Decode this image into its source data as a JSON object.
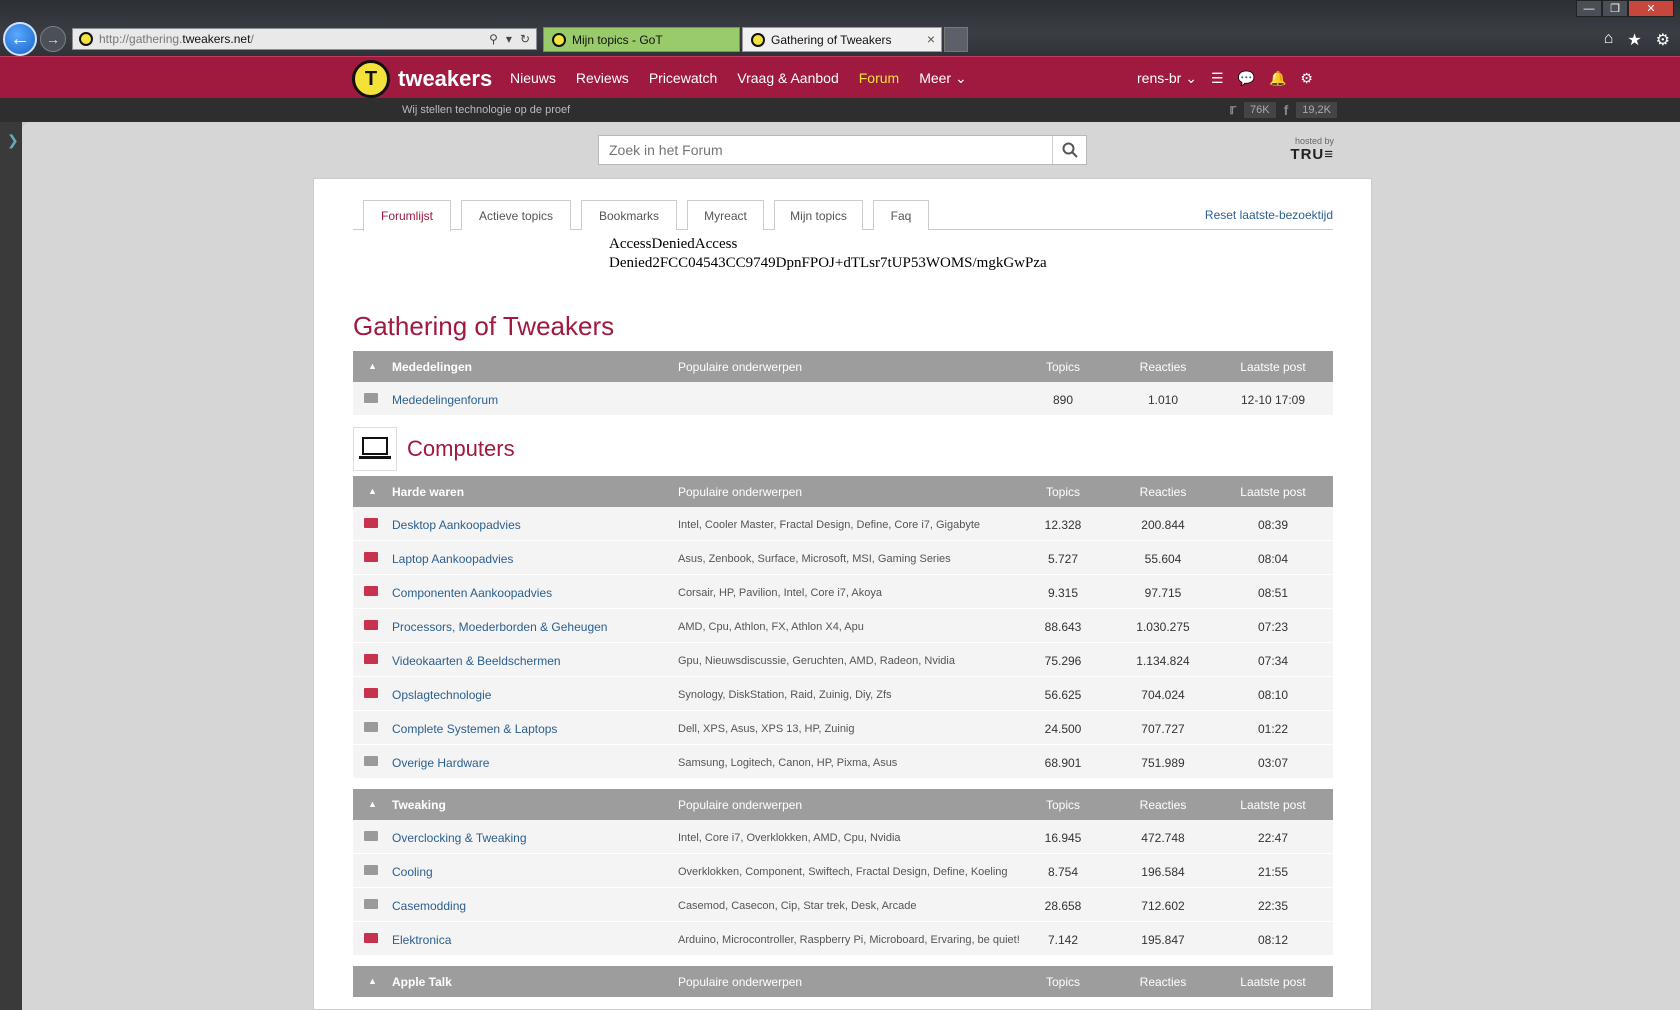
{
  "browser": {
    "url_prefix": "http://gathering.",
    "url_domain": "tweakers.net",
    "url_suffix": "/",
    "tabs": [
      {
        "label": "Mijn topics - GoT"
      },
      {
        "label": "Gathering of Tweakers"
      }
    ]
  },
  "site": {
    "logo_text": "tweakers",
    "nav": [
      "Nieuws",
      "Reviews",
      "Pricewatch",
      "Vraag & Aanbod",
      "Forum",
      "Meer"
    ],
    "user": "rens-br",
    "tagline": "Wij stellen technologie op de proef",
    "twitter_count": "76K",
    "facebook_count": "19,2K"
  },
  "search": {
    "placeholder": "Zoek in het Forum",
    "hosted_by": "hosted by",
    "hosted_brand": "TRU≡"
  },
  "forum_tabs": {
    "items": [
      "Forumlijst",
      "Actieve topics",
      "Bookmarks",
      "Myreact",
      "Mijn topics",
      "Faq"
    ],
    "reset": "Reset laatste-bezoektijd"
  },
  "error": {
    "line1": "AccessDeniedAccess",
    "line2": "Denied2FCC04543CC9749DpnFPOJ+dTLsr7tUP53WOMS/mgkGwPza"
  },
  "page_title": "Gathering of Tweakers",
  "columns": {
    "popular": "Populaire onderwerpen",
    "topics": "Topics",
    "reacties": "Reacties",
    "last": "Laatste post"
  },
  "sections": {
    "mededelingen": {
      "name": "Mededelingen",
      "rows": [
        {
          "name": "Mededelingenforum",
          "popular": "",
          "topics": "890",
          "reacties": "1.010",
          "last": "12-10 17:09"
        }
      ]
    },
    "computers_title": "Computers",
    "harde_waren": {
      "name": "Harde waren",
      "rows": [
        {
          "name": "Desktop Aankoopadvies",
          "popular": "Intel, Cooler Master, Fractal Design, Define, Core i7, Gigabyte",
          "topics": "12.328",
          "reacties": "200.844",
          "last": "08:39"
        },
        {
          "name": "Laptop Aankoopadvies",
          "popular": "Asus, Zenbook, Surface, Microsoft, MSI, Gaming Series",
          "topics": "5.727",
          "reacties": "55.604",
          "last": "08:04"
        },
        {
          "name": "Componenten Aankoopadvies",
          "popular": "Corsair, HP, Pavilion, Intel, Core i7, Akoya",
          "topics": "9.315",
          "reacties": "97.715",
          "last": "08:51"
        },
        {
          "name": "Processors, Moederborden & Geheugen",
          "popular": "AMD, Cpu, Athlon, FX, Athlon X4, Apu",
          "topics": "88.643",
          "reacties": "1.030.275",
          "last": "07:23"
        },
        {
          "name": "Videokaarten & Beeldschermen",
          "popular": "Gpu, Nieuwsdiscussie, Geruchten, AMD, Radeon, Nvidia",
          "topics": "75.296",
          "reacties": "1.134.824",
          "last": "07:34"
        },
        {
          "name": "Opslagtechnologie",
          "popular": "Synology, DiskStation, Raid, Zuinig, Diy, Zfs",
          "topics": "56.625",
          "reacties": "704.024",
          "last": "08:10"
        },
        {
          "name": "Complete Systemen & Laptops",
          "popular": "Dell, XPS, Asus, XPS 13, HP, Zuinig",
          "topics": "24.500",
          "reacties": "707.727",
          "last": "01:22"
        },
        {
          "name": "Overige Hardware",
          "popular": "Samsung, Logitech, Canon, HP, Pixma, Asus",
          "topics": "68.901",
          "reacties": "751.989",
          "last": "03:07"
        }
      ]
    },
    "tweaking": {
      "name": "Tweaking",
      "rows": [
        {
          "name": "Overclocking & Tweaking",
          "popular": "Intel, Core i7, Overklokken, AMD, Cpu, Nvidia",
          "topics": "16.945",
          "reacties": "472.748",
          "last": "22:47"
        },
        {
          "name": "Cooling",
          "popular": "Overklokken, Component, Swiftech, Fractal Design, Define, Koeling",
          "topics": "8.754",
          "reacties": "196.584",
          "last": "21:55"
        },
        {
          "name": "Casemodding",
          "popular": "Casemod, Casecon, Cip, Star trek, Desk, Arcade",
          "topics": "28.658",
          "reacties": "712.602",
          "last": "22:35"
        },
        {
          "name": "Elektronica",
          "popular": "Arduino, Microcontroller, Raspberry Pi, Microboard, Ervaring, be quiet!",
          "topics": "7.142",
          "reacties": "195.847",
          "last": "08:12"
        }
      ]
    },
    "apple_talk": {
      "name": "Apple Talk"
    }
  }
}
